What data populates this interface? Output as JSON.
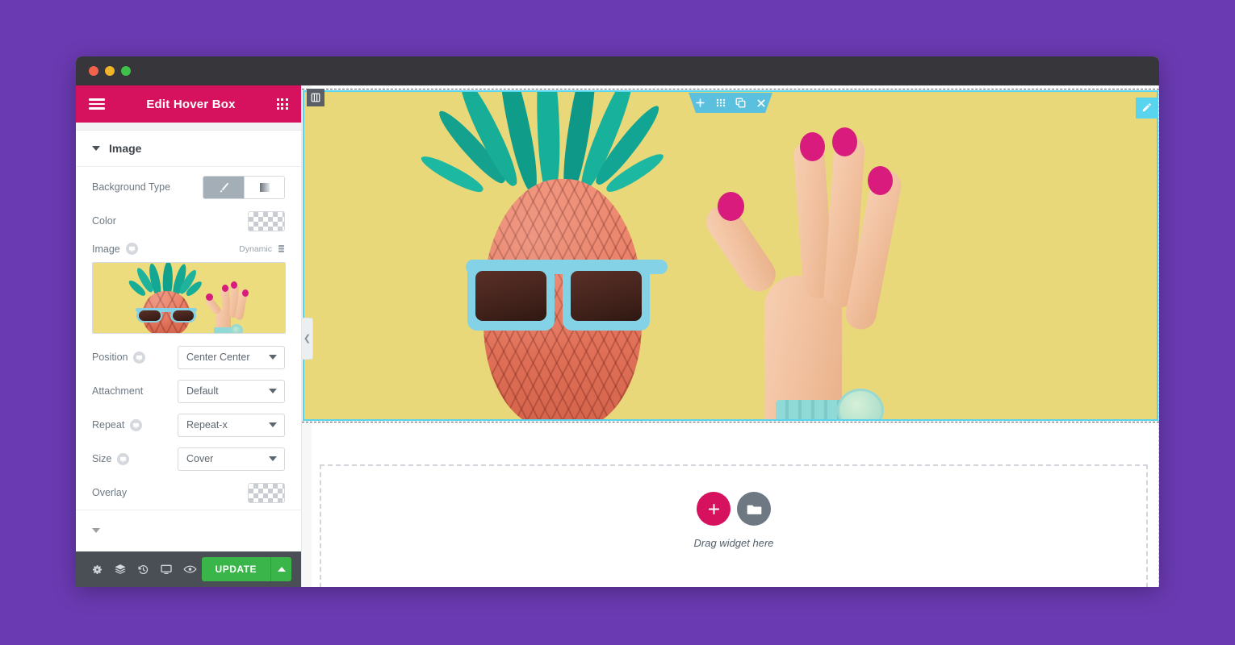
{
  "desktop": {
    "background_color": "#6a3ab2"
  },
  "window": {
    "traffic_lights": [
      "close",
      "minimize",
      "zoom"
    ],
    "titlebar_color": "#36363b"
  },
  "panel": {
    "header": {
      "title": "Edit Hover Box",
      "background_color": "#d6125e",
      "menu_icon": "hamburger-icon",
      "apps_icon": "grid-apps-icon"
    },
    "section": {
      "title": "Image",
      "expanded": true,
      "caret_icon": "caret-down-icon"
    },
    "controls": [
      {
        "id": "background-type",
        "label": "Background Type",
        "type": "toggle-group",
        "options": [
          {
            "value": "classic",
            "icon": "paintbrush-icon",
            "selected": true
          },
          {
            "value": "gradient",
            "icon": "gradient-icon",
            "selected": false
          }
        ]
      },
      {
        "id": "color",
        "label": "Color",
        "type": "color-swatch",
        "value": "transparent"
      },
      {
        "id": "image",
        "label": "Image",
        "type": "media",
        "responsive_icon": "responsive-toggle-icon",
        "dynamic_label": "Dynamic",
        "dynamic_icon": "database-icon"
      },
      {
        "id": "position",
        "label": "Position",
        "type": "select",
        "value": "Center Center",
        "responsive_icon": "responsive-toggle-icon"
      },
      {
        "id": "attachment",
        "label": "Attachment",
        "type": "select",
        "value": "Default"
      },
      {
        "id": "repeat",
        "label": "Repeat",
        "type": "select",
        "value": "Repeat-x",
        "responsive_icon": "responsive-toggle-icon"
      },
      {
        "id": "size",
        "label": "Size",
        "type": "select",
        "value": "Cover",
        "responsive_icon": "responsive-toggle-icon"
      },
      {
        "id": "overlay",
        "label": "Overlay",
        "type": "color-swatch",
        "value": "transparent"
      }
    ],
    "footer": {
      "icons": [
        "settings-gear-icon",
        "navigator-layers-icon",
        "history-clock-icon",
        "responsive-mode-monitor-icon",
        "preview-eye-icon"
      ],
      "update_label": "UPDATE",
      "update_color": "#39b54a",
      "update_arrow_icon": "caret-up-icon"
    },
    "collapse_tab_icon": "chevron-left-icon"
  },
  "canvas": {
    "panel_toggle_icon": "panel-columns-icon",
    "section_toolbar": {
      "color": "#5bc0de",
      "icons": [
        "add-section-icon",
        "columns-handle-icon",
        "duplicate-icon",
        "close-icon"
      ]
    },
    "edit_handle_icon": "pencil-edit-icon",
    "hero": {
      "alt": "pineapple-with-sunglasses-and-hand-ok-gesture",
      "background_color": "#e8d87a",
      "selected_outline_color": "#59d4ef"
    },
    "empty_section": {
      "add_widget_icon": "plus-icon",
      "add_template_icon": "folder-icon",
      "label": "Drag widget here",
      "add_button_color": "#d6125e",
      "template_button_color": "#6d7882"
    }
  }
}
